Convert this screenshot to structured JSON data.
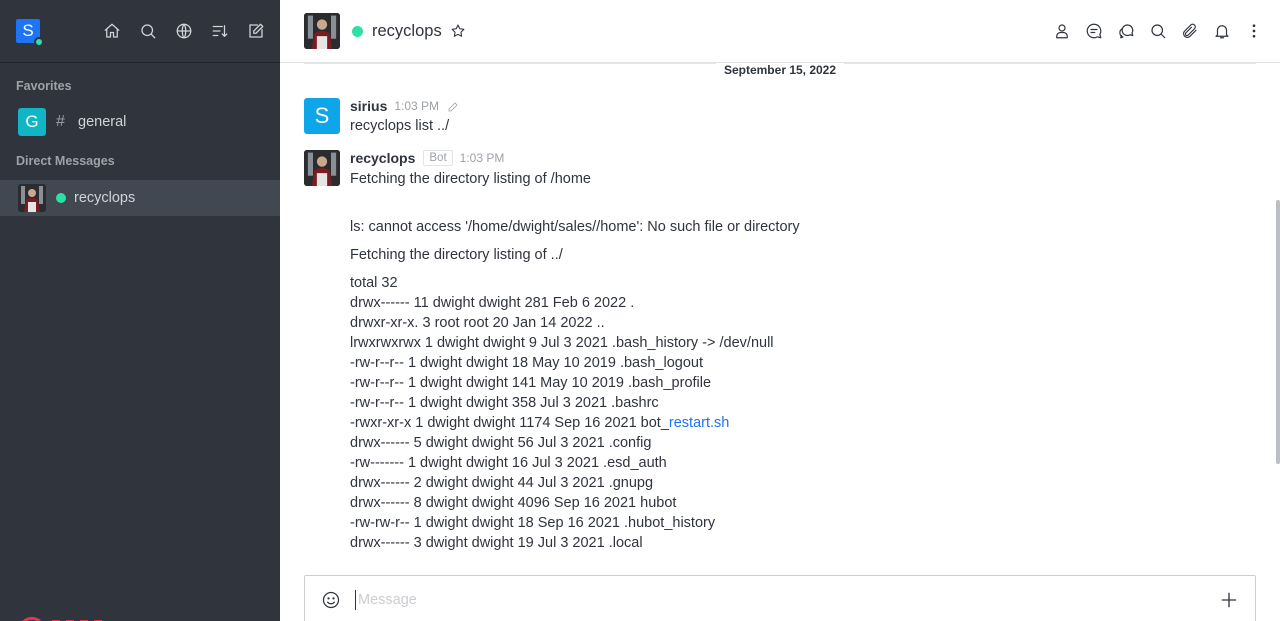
{
  "workspace": {
    "initial": "S",
    "status_color": "#2de0a5"
  },
  "sidebar": {
    "favorites_title": "Favorites",
    "dm_title": "Direct Messages",
    "favorites": [
      {
        "initial": "G",
        "prefix": "#",
        "name": "general"
      }
    ],
    "direct_messages": [
      {
        "name": "recyclops",
        "status": "online"
      }
    ]
  },
  "room": {
    "title": "recyclops",
    "status": "online"
  },
  "messages": {
    "date": "September 15, 2022",
    "items": [
      {
        "author": "sirius",
        "initial": "S",
        "time": "1:03 PM",
        "lines": [
          "recyclops list ../"
        ]
      },
      {
        "author": "recyclops",
        "tag": "Bot",
        "time": "1:03 PM",
        "lines": [
          "Fetching the directory listing of /home",
          "ls: cannot access '/home/dwight/sales//home': No such file or directory",
          "Fetching the directory listing of ../",
          "total 32",
          "drwx------ 11 dwight dwight 281 Feb 6 2022 .",
          "drwxr-xr-x. 3 root root 20 Jan 14 2022 ..",
          "lrwxrwxrwx 1 dwight dwight 9 Jul 3 2021 .bash_history -> /dev/null",
          "-rw-r--r-- 1 dwight dwight 18 May 10 2019 .bash_logout",
          "-rw-r--r-- 1 dwight dwight 141 May 10 2019 .bash_profile",
          "-rw-r--r-- 1 dwight dwight 358 Jul 3 2021 .bashrc",
          "-rwxr-xr-x 1 dwight dwight 1174 Sep 16 2021 bot_",
          "drwx------ 5 dwight dwight 56 Jul 3 2021 .config",
          "-rw------- 1 dwight dwight 16 Jul 3 2021 .esd_auth",
          "drwx------ 2 dwight dwight 44 Jul 3 2021 .gnupg",
          "drwx------ 8 dwight dwight 4096 Sep 16 2021 hubot",
          "-rw-rw-r-- 1 dwight dwight 18 Sep 16 2021 .hubot_history",
          "drwx------ 3 dwight dwight 19 Jul 3 2021 .local"
        ],
        "link_text": "restart.sh"
      }
    ]
  },
  "composer": {
    "placeholder": "Message"
  },
  "colors": {
    "sidebar_bg": "#2f343d",
    "accent": "#1d74f5",
    "online": "#2de0a5"
  }
}
